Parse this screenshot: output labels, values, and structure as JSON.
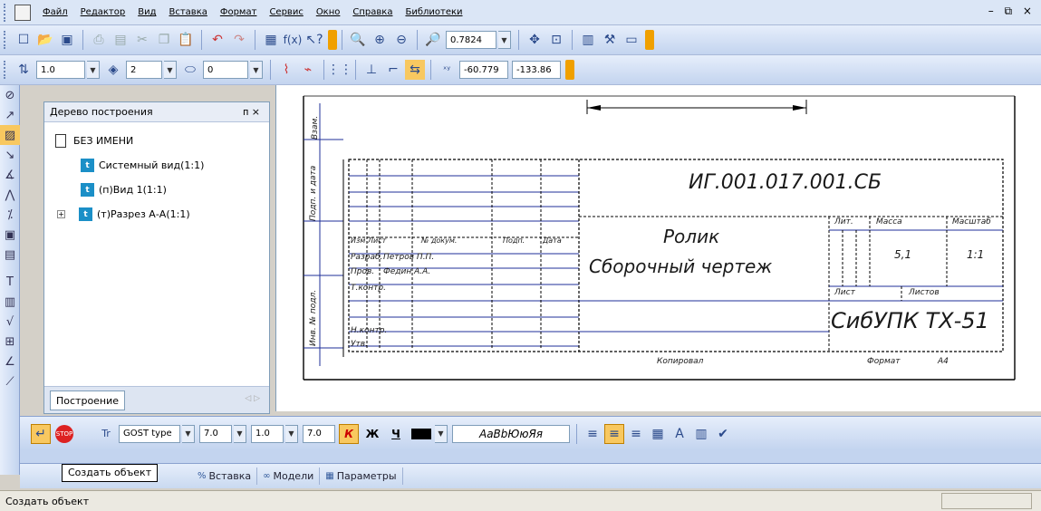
{
  "menu": {
    "items": [
      "Файл",
      "Редактор",
      "Вид",
      "Вставка",
      "Формат",
      "Сервис",
      "Окно",
      "Справка",
      "Библиотеки"
    ],
    "window_controls": "– ⧉ ×"
  },
  "toolbar1": {
    "zoom_value": "0.7824"
  },
  "toolbar2": {
    "line_width": "1.0",
    "layer_value": "2",
    "style_value": "0",
    "coord_x": "-60.779",
    "coord_y": "-133.86"
  },
  "tree_panel": {
    "title": "Дерево построения",
    "pin_close": "ᴨ ×",
    "root": "БЕЗ ИМЕНИ",
    "nodes": [
      {
        "label": "Системный вид(1:1)"
      },
      {
        "label": "(п)Вид 1(1:1)"
      },
      {
        "label": "(т)Разрез А-А(1:1)"
      }
    ],
    "tab_label": "Построение",
    "tab_arrows": "◁ ▷"
  },
  "drawing": {
    "designation": "ИГ.001.017.001.СБ",
    "name_line1": "Ролик",
    "name_line2": "Сборочный чертеж",
    "organization": "СибУПК ТХ-51",
    "mass_value": "5,1",
    "scale_value": "1:1",
    "col_headers": [
      "Изм",
      "Лист",
      "№ докум.",
      "Подп.",
      "Дата"
    ],
    "row_labels": [
      "Разраб.",
      "Пров.",
      "Т.контр.",
      "Н.контр.",
      "Утв."
    ],
    "developer": "Петров П.П.",
    "checker": "Федин А.А.",
    "lit_label": "Лит.",
    "mass_label": "Масса",
    "scale_label": "Масштаб",
    "sheet_label": "Лист",
    "sheets_label": "Листов",
    "copied_label": "Копировал",
    "format_label": "Формат",
    "format_value": "А4",
    "side_labels": [
      "Взам.",
      "Подп. и дата",
      "Инв. № подл."
    ]
  },
  "props": {
    "font_name": "GOST type",
    "font_size": "7.0",
    "spacing": "1.0",
    "height": "7.0",
    "bold": "К",
    "italic": "Ж",
    "underline": "Ч",
    "sample": "АаBbЮюЯя"
  },
  "tabs": [
    {
      "icon": "%",
      "label": "Вставка"
    },
    {
      "icon": "∞",
      "label": "Модели"
    },
    {
      "icon": "▦",
      "label": "Параметры"
    }
  ],
  "tooltip": "Создать объект",
  "status_text": "Создать объект",
  "colors": {
    "toolbar": "#c3d4ef",
    "accent_orange": "#f0a000",
    "tree_icon": "#1b8fc7"
  }
}
